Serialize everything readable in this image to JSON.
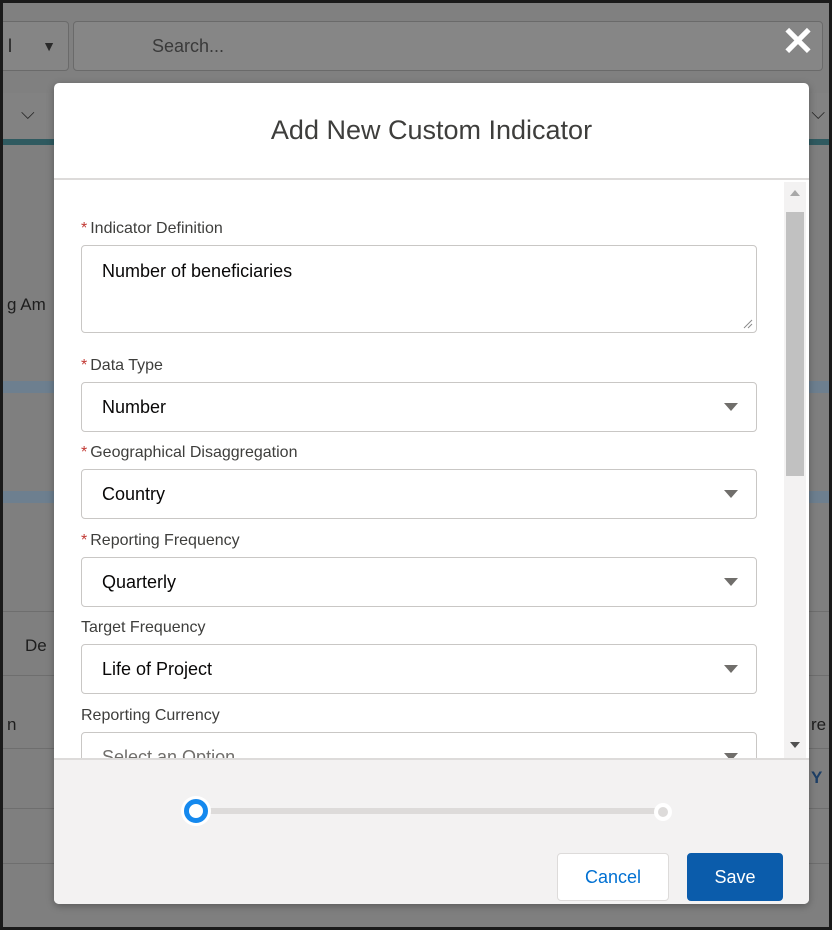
{
  "background": {
    "filter_value": "l",
    "search_placeholder": "Search...",
    "fragments": {
      "left_amount": "g Am",
      "left_dec": "De",
      "left_n": "n",
      "right_re": "re F",
      "right_y": "Y"
    }
  },
  "modal": {
    "title": "Add New Custom Indicator",
    "required_marker": "*",
    "fields": {
      "indicator_definition": {
        "label": "Indicator Definition",
        "value": "Number of beneficiaries"
      },
      "data_type": {
        "label": "Data Type",
        "value": "Number"
      },
      "geo_disaggregation": {
        "label": "Geographical Disaggregation",
        "value": "Country"
      },
      "reporting_frequency": {
        "label": "Reporting Frequency",
        "value": "Quarterly"
      },
      "target_frequency": {
        "label": "Target Frequency",
        "value": "Life of Project"
      },
      "reporting_currency": {
        "label": "Reporting Currency",
        "value": "Select an Option"
      }
    },
    "progress": {
      "current_step": 1,
      "total_steps": 2
    },
    "buttons": {
      "cancel": "Cancel",
      "save": "Save"
    }
  },
  "colors": {
    "primary": "#0b5cab",
    "link": "#0070d2",
    "required": "#c23934",
    "progress_active": "#1589ee"
  },
  "icons": [
    "close-icon",
    "chevron-down-icon",
    "caret-down-icon",
    "resize-handle-icon",
    "scroll-up-icon",
    "scroll-down-icon"
  ]
}
